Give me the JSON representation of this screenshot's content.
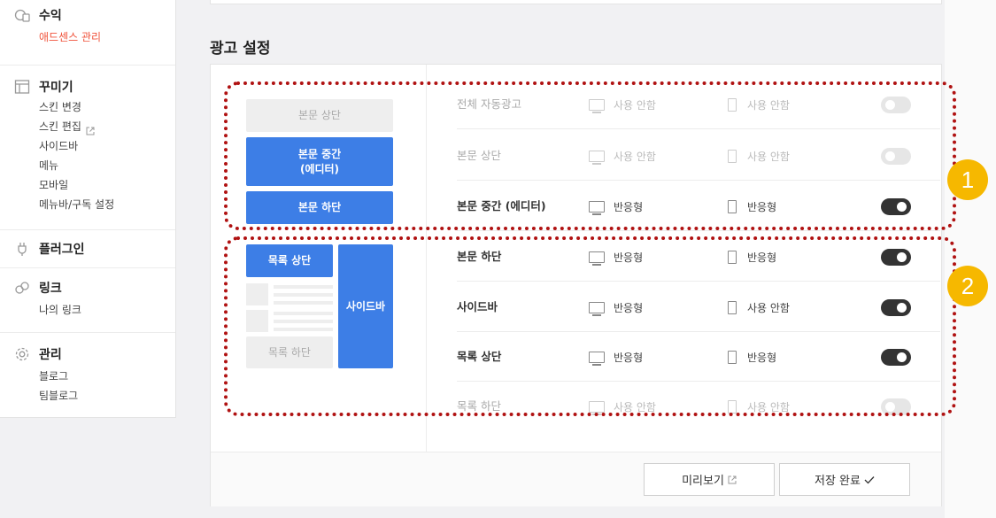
{
  "sidebar": {
    "groups": [
      {
        "icon": "money-icon",
        "title": "수익",
        "items": [
          "애드센스 관리"
        ],
        "active_index": 0
      },
      {
        "icon": "layout-icon",
        "title": "꾸미기",
        "items": [
          "스킨 변경",
          "스킨 편집",
          "사이드바",
          "메뉴",
          "모바일",
          "메뉴바/구독 설정"
        ]
      },
      {
        "icon": "plug-icon",
        "title": "플러그인",
        "items": []
      },
      {
        "icon": "link-icon",
        "title": "링크",
        "items": [
          "나의 링크"
        ]
      },
      {
        "icon": "gear-icon",
        "title": "관리",
        "items": [
          "블로그",
          "팀블로그"
        ]
      }
    ]
  },
  "main": {
    "section_title": "광고 설정",
    "preview": {
      "body_top": "본문 상단",
      "body_middle": "본문 중간\n(에디터)",
      "body_bottom": "본문 하단",
      "list_top": "목록 상단",
      "sidebar": "사이드바",
      "list_bottom": "목록 하단"
    },
    "rows": [
      {
        "label": "전체 자동광고",
        "pc": "사용 안함",
        "mobile": "사용 안함",
        "enabled": false,
        "disabled": true
      },
      {
        "label": "본문 상단",
        "pc": "사용 안함",
        "mobile": "사용 안함",
        "enabled": false,
        "disabled": true
      },
      {
        "label": "본문 중간 (에디터)",
        "pc": "반응형",
        "mobile": "반응형",
        "enabled": true,
        "disabled": false
      },
      {
        "label": "본문 하단",
        "pc": "반응형",
        "mobile": "반응형",
        "enabled": true,
        "disabled": false
      },
      {
        "label": "사이드바",
        "pc": "반응형",
        "mobile": "사용 안함",
        "enabled": true,
        "disabled": false
      },
      {
        "label": "목록 상단",
        "pc": "반응형",
        "mobile": "반응형",
        "enabled": true,
        "disabled": false
      },
      {
        "label": "목록 하단",
        "pc": "사용 안함",
        "mobile": "사용 안함",
        "enabled": false,
        "disabled": true
      }
    ],
    "buttons": {
      "preview": "미리보기",
      "save": "저장 완료"
    }
  },
  "annotations": {
    "marker1": "1",
    "marker2": "2"
  },
  "colors": {
    "accent_blue": "#3d7ee6",
    "active_red": "#f0533b",
    "marker_yellow": "#f6b800",
    "dotted_red": "#b01212"
  }
}
